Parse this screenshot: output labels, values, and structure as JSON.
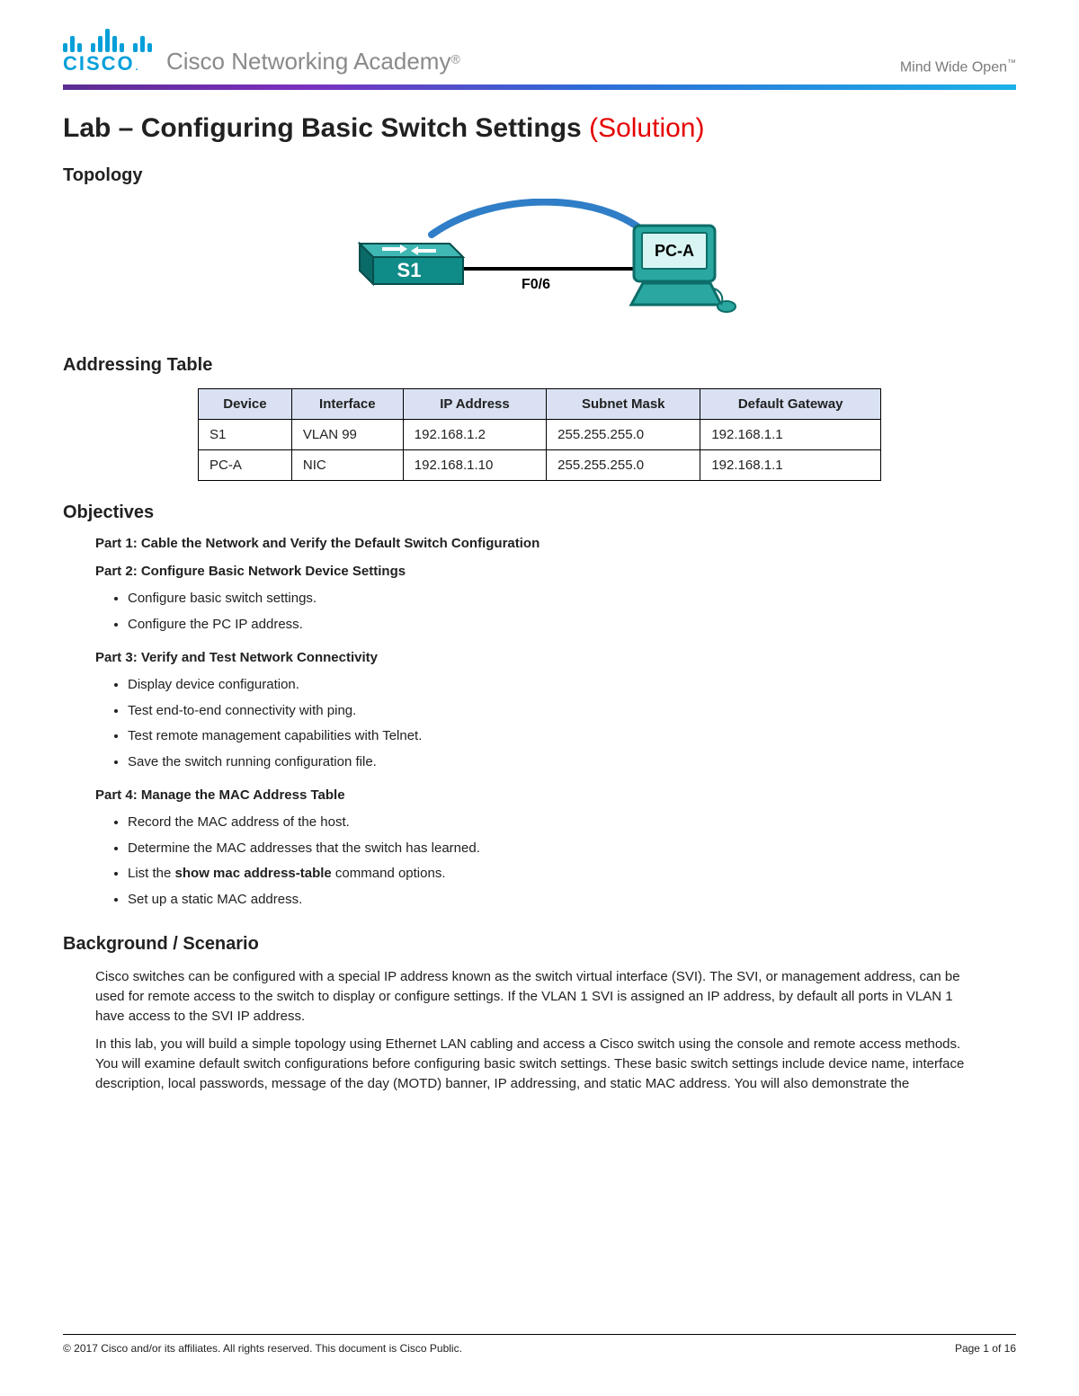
{
  "header": {
    "brand": "CISCO",
    "academy": "Cisco Networking Academy",
    "reg": "®",
    "tagline": "Mind Wide Open",
    "tm": "™"
  },
  "title": {
    "main": "Lab – Configuring Basic Switch Settings",
    "solution": "(Solution)"
  },
  "topology": {
    "heading": "Topology",
    "s1": "S1",
    "pca": "PC-A",
    "link": "F0/6"
  },
  "addressing": {
    "heading": "Addressing Table",
    "headers": [
      "Device",
      "Interface",
      "IP Address",
      "Subnet Mask",
      "Default Gateway"
    ],
    "rows": [
      [
        "S1",
        "VLAN 99",
        "192.168.1.2",
        "255.255.255.0",
        "192.168.1.1"
      ],
      [
        "PC-A",
        "NIC",
        "192.168.1.10",
        "255.255.255.0",
        "192.168.1.1"
      ]
    ]
  },
  "objectives": {
    "heading": "Objectives",
    "part1": "Part 1: Cable the Network and Verify the Default Switch Configuration",
    "part2": {
      "title": "Part 2: Configure Basic Network Device Settings",
      "items": [
        "Configure basic switch settings.",
        "Configure the PC IP address."
      ]
    },
    "part3": {
      "title": "Part 3: Verify and Test Network Connectivity",
      "items": [
        "Display device configuration.",
        "Test end-to-end connectivity with ping.",
        "Test remote management capabilities with Telnet.",
        "Save the switch running configuration file."
      ]
    },
    "part4": {
      "title": "Part 4: Manage the MAC Address Table",
      "items_pre": [
        "Record the MAC address of the host.",
        "Determine the MAC addresses that the switch has learned."
      ],
      "item_cmd_pre": "List the ",
      "item_cmd": "show mac address-table",
      "item_cmd_post": " command options.",
      "items_post": [
        "Set up a static MAC address."
      ]
    }
  },
  "background": {
    "heading": "Background / Scenario",
    "p1": "Cisco switches can be configured with a special IP address known as the switch virtual interface (SVI). The SVI, or management address, can be used for remote access to the switch to display or configure settings. If the VLAN 1 SVI is assigned an IP address, by default all ports in VLAN 1 have access to the SVI IP address.",
    "p2": "In this lab, you will build a simple topology using Ethernet LAN cabling and access a Cisco switch using the console and remote access methods. You will examine default switch configurations before configuring basic switch settings. These basic switch settings include device name, interface description, local passwords, message of the day (MOTD) banner, IP addressing, and static MAC address. You will also demonstrate the"
  },
  "footer": {
    "copyright": "© 2017 Cisco and/or its affiliates. All rights reserved. This document is Cisco Public.",
    "page": "Page 1 of 16"
  }
}
